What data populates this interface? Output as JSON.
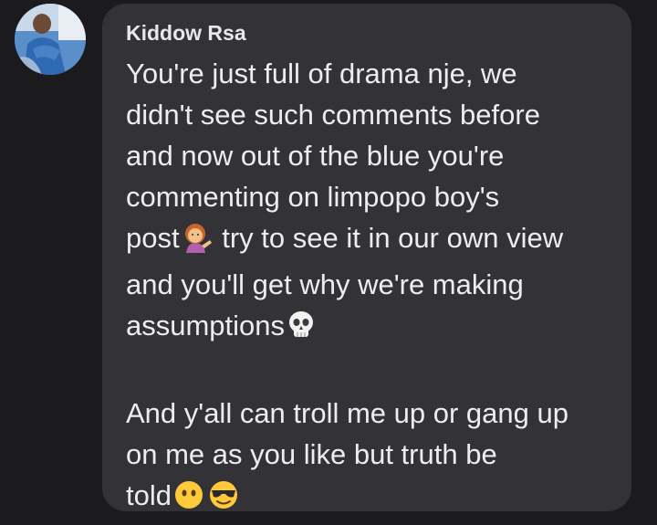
{
  "comment": {
    "author": "Kiddow Rsa",
    "avatar_icon": "user-avatar-photo",
    "paragraph_1": {
      "lines": [
        "You're just full of drama nje, we",
        "didn't see such comments before",
        "and now out of the blue you're",
        "commenting on limpopo boy's"
      ],
      "line5_before": "post",
      "line5_emoji": "woman-tipping-hand-emoji",
      "line5_after": " try to see it in our own view",
      "line6": "and you'll get why we're making",
      "line7_before": "assumptions",
      "line7_emoji": "skull-emoji"
    },
    "paragraph_2": {
      "lines": [
        "And y'all can troll me up or gang up",
        "on me as you like but truth be"
      ],
      "line3_before": "told",
      "line3_emojis": [
        "face-without-mouth-emoji",
        "smiling-face-with-sunglasses-emoji"
      ]
    }
  },
  "colors": {
    "background": "#1b1b1d",
    "bubble": "#333337",
    "text": "#ededee"
  }
}
